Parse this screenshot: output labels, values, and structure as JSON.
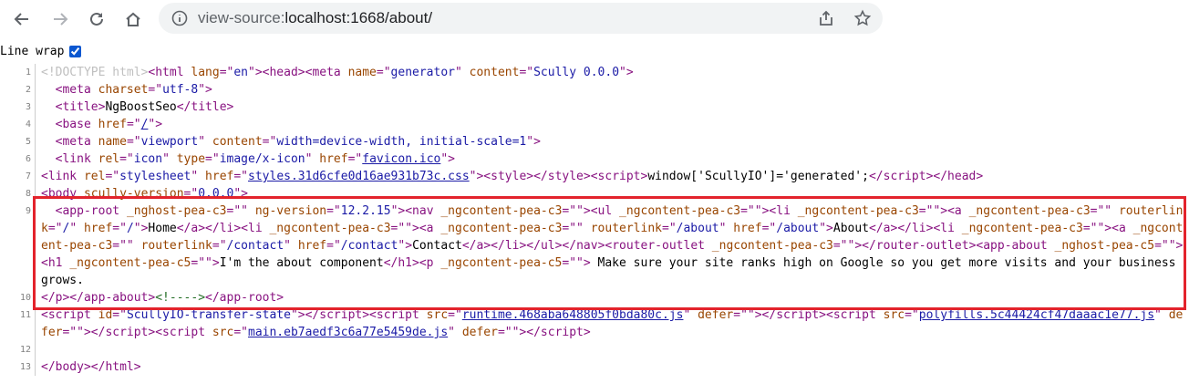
{
  "browser": {
    "url_scheme": "view-source:",
    "url_rest": "localhost:1668/about/",
    "back_icon": "back-arrow-icon",
    "forward_icon": "forward-arrow-icon",
    "reload_icon": "reload-icon",
    "home_icon": "home-icon",
    "info_icon": "info-icon",
    "share_icon": "share-icon",
    "star_icon": "star-icon"
  },
  "line_wrap": {
    "label": "Line wrap",
    "checked": true
  },
  "line_numbers": [
    "1",
    "2",
    "3",
    "4",
    "5",
    "6",
    "7",
    "8",
    "9",
    "10",
    "11",
    "12",
    "13"
  ],
  "highlight_color": "#e3232c"
}
